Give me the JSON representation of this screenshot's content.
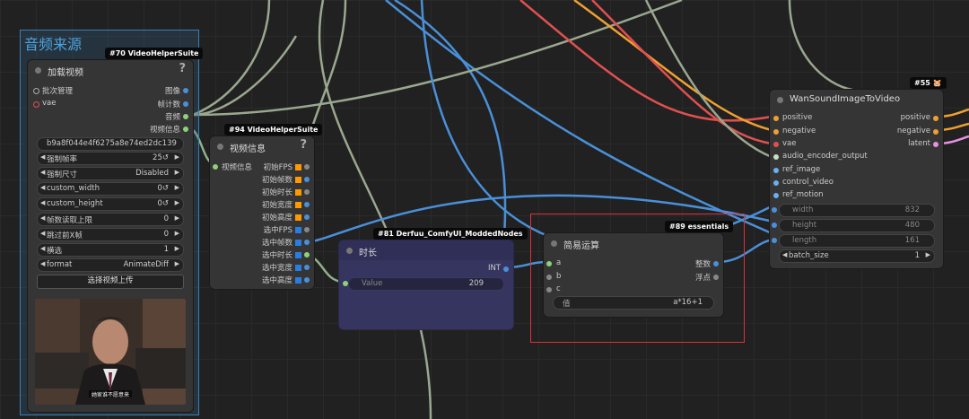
{
  "group": {
    "title": "音频来源"
  },
  "node70": {
    "tag": "#70 VideoHelperSuite",
    "title": "加载视频",
    "help": "?",
    "inputs": [
      "批次管理",
      "vae"
    ],
    "outputs": [
      "图像",
      "帧计数",
      "音频",
      "视频信息"
    ],
    "filename": "b9a8f044e4f6275a8e74ed2dc139 ...",
    "widgets": [
      {
        "label": "强制帧率",
        "value": "25↺"
      },
      {
        "label": "强制尺寸",
        "value": "Disabled"
      },
      {
        "label": "custom_width",
        "value": "0↺"
      },
      {
        "label": "custom_height",
        "value": "0↺"
      },
      {
        "label": "帧数读取上限",
        "value": "0"
      },
      {
        "label": "跳过前X帧",
        "value": "0"
      },
      {
        "label": "横选",
        "value": "1"
      },
      {
        "label": "format",
        "value": "AnimateDiff"
      }
    ],
    "upload_button": "选择视频上传",
    "subtitle": "她家谁不愿意来"
  },
  "node94": {
    "tag": "#94 VideoHelperSuite",
    "title": "视频信息",
    "help": "?",
    "input": "视频信息",
    "outputs": [
      "初始FPS",
      "初始帧数",
      "初始时长",
      "初始宽度",
      "初始高度",
      "选中FPS",
      "选中帧数",
      "选中时长",
      "选中宽度",
      "选中高度"
    ]
  },
  "node81": {
    "tag": "#81 Derfuu_ComfyUI_ModdedNodes",
    "title": "时长",
    "output": "INT",
    "widget": {
      "label": "Value",
      "value": "209"
    }
  },
  "node89": {
    "tag": "#89 essentials",
    "title": "简易运算",
    "inputs": [
      "a",
      "b",
      "c"
    ],
    "outputs": [
      "整数",
      "浮点"
    ],
    "widget": {
      "label": "值",
      "value": "a*16+1"
    }
  },
  "node55": {
    "tag": "#55 🐹",
    "title": "WanSoundImageToVideo",
    "inputs": [
      "positive",
      "negative",
      "vae",
      "audio_encoder_output",
      "ref_image",
      "control_video",
      "ref_motion"
    ],
    "outputs": [
      "positive",
      "negative",
      "latent"
    ],
    "widgets": [
      {
        "label": "width",
        "value": "832"
      },
      {
        "label": "height",
        "value": "480"
      },
      {
        "label": "length",
        "value": "161"
      }
    ],
    "batch": {
      "label": "batch_size",
      "value": "1"
    }
  },
  "colors": {
    "accent_highlight": "#e0303a",
    "group_border": "#3b7fb3",
    "wire_green": "#8fb08a",
    "wire_blue": "#4a90d9",
    "wire_orange": "#f0a030",
    "wire_red": "#e05050"
  }
}
